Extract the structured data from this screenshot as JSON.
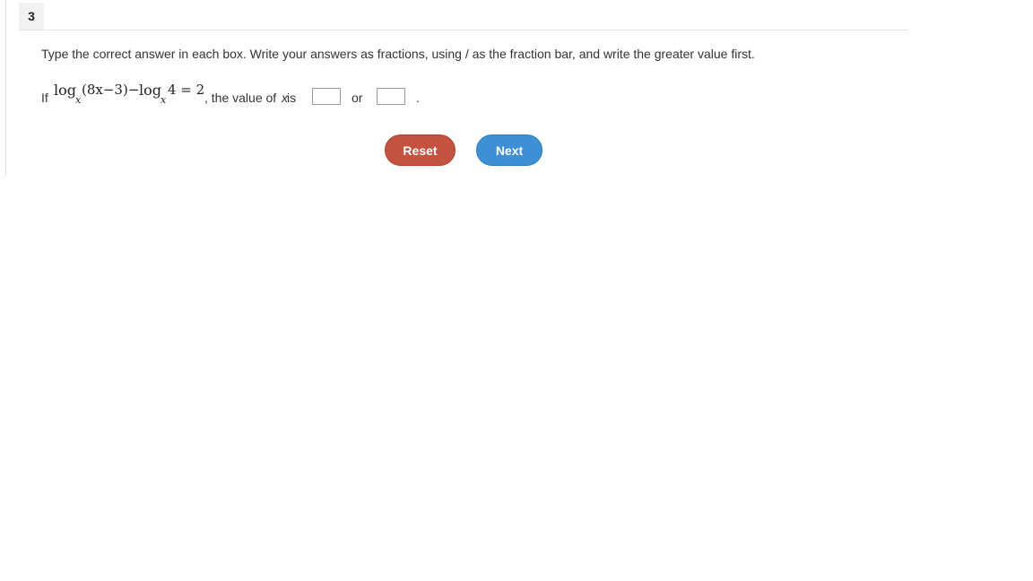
{
  "question": {
    "number": "3",
    "instruction": "Type the correct answer in each box. Write your answers as fractions, using / as the fraction bar, and write the greater value first.",
    "prefix": "If",
    "equation": {
      "log1": "log",
      "base1": "x",
      "argument": "(8x−3)−",
      "log2": "log",
      "base2": "x",
      "rhs": "4 = 2"
    },
    "middle_text": ", the value of",
    "variable": "x",
    "after_variable": " is",
    "answer_1": "",
    "answer_2": "",
    "or_text": "or",
    "end_text": "."
  },
  "buttons": {
    "reset": "Reset",
    "next": "Next"
  },
  "colors": {
    "reset": "#c4523f",
    "next": "#3d8fd6"
  }
}
